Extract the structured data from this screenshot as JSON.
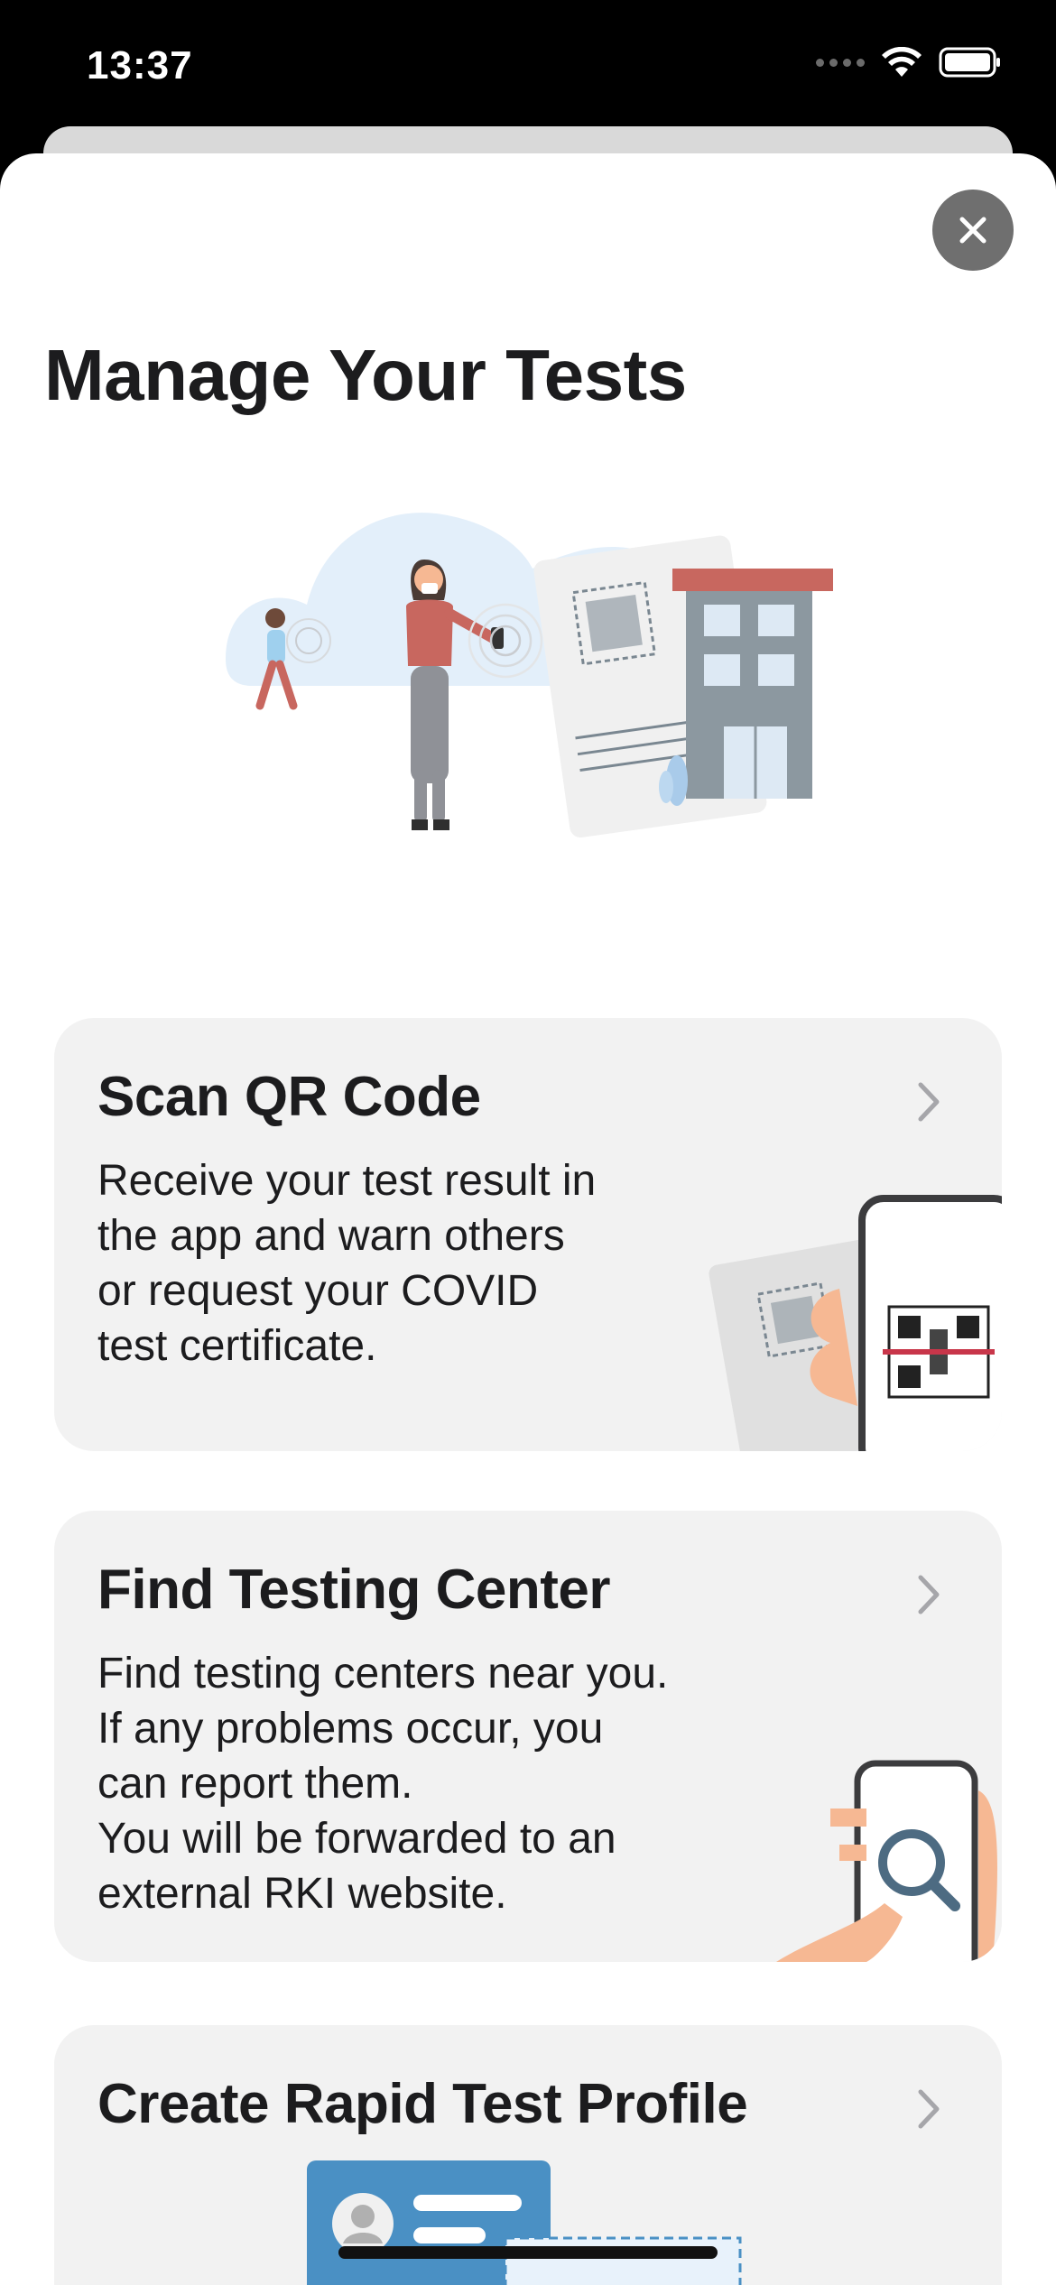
{
  "status_bar": {
    "time": "13:37",
    "icons": [
      "cellular-signal-icon",
      "wifi-icon",
      "battery-icon"
    ]
  },
  "sheet": {
    "close_icon": "close-icon",
    "title": "Manage Your Tests"
  },
  "cards": [
    {
      "title": "Scan QR Code",
      "description": "Receive your test result in\nthe app and warn others\nor request your COVID\ntest certificate.",
      "icon": "chevron-right-icon"
    },
    {
      "title": "Find Testing Center",
      "description": "Find testing centers near you.\nIf any problems occur, you\ncan report them.\nYou will be forwarded to an\nexternal RKI website.",
      "icon": "chevron-right-icon"
    },
    {
      "title": "Create Rapid Test Profile",
      "icon": "chevron-right-icon"
    }
  ],
  "colors": {
    "card_background": "#f2f2f2",
    "close_button": "#6f6f6f",
    "accent_blue": "#4a90c4",
    "skin": "#f6b893",
    "building": "#8c98a0",
    "roof": "#c8675f"
  }
}
